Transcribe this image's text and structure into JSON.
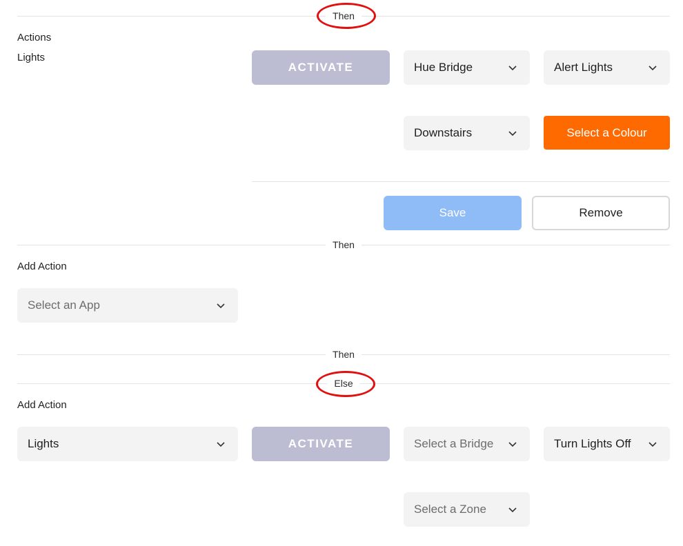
{
  "dividers": {
    "then_top": "Then",
    "then_middle": "Then",
    "then_lower": "Then",
    "else_label": "Else"
  },
  "action_block": {
    "section_label": "Actions",
    "app_label": "Lights",
    "activate_label": "ACTIVATE",
    "bridge_select": "Hue Bridge",
    "mode_select": "Alert Lights",
    "zone_select": "Downstairs",
    "colour_button": "Select a Colour",
    "save_button": "Save",
    "remove_button": "Remove"
  },
  "add_action_then": {
    "section_label": "Add Action",
    "app_select_placeholder": "Select an App"
  },
  "add_action_else": {
    "section_label": "Add Action",
    "app_select": "Lights",
    "activate_label": "ACTIVATE",
    "bridge_placeholder": "Select a Bridge",
    "mode_select": "Turn Lights Off",
    "zone_placeholder": "Select a Zone"
  },
  "colors": {
    "annotation_ring": "#e01010",
    "activate_disabled": "#bcbcd2",
    "colour_button": "#ff6a00",
    "save_disabled": "#8fbbf7",
    "select_bg": "#f3f3f4"
  },
  "icons": {
    "select_chevron": "chevron-down-icon"
  }
}
